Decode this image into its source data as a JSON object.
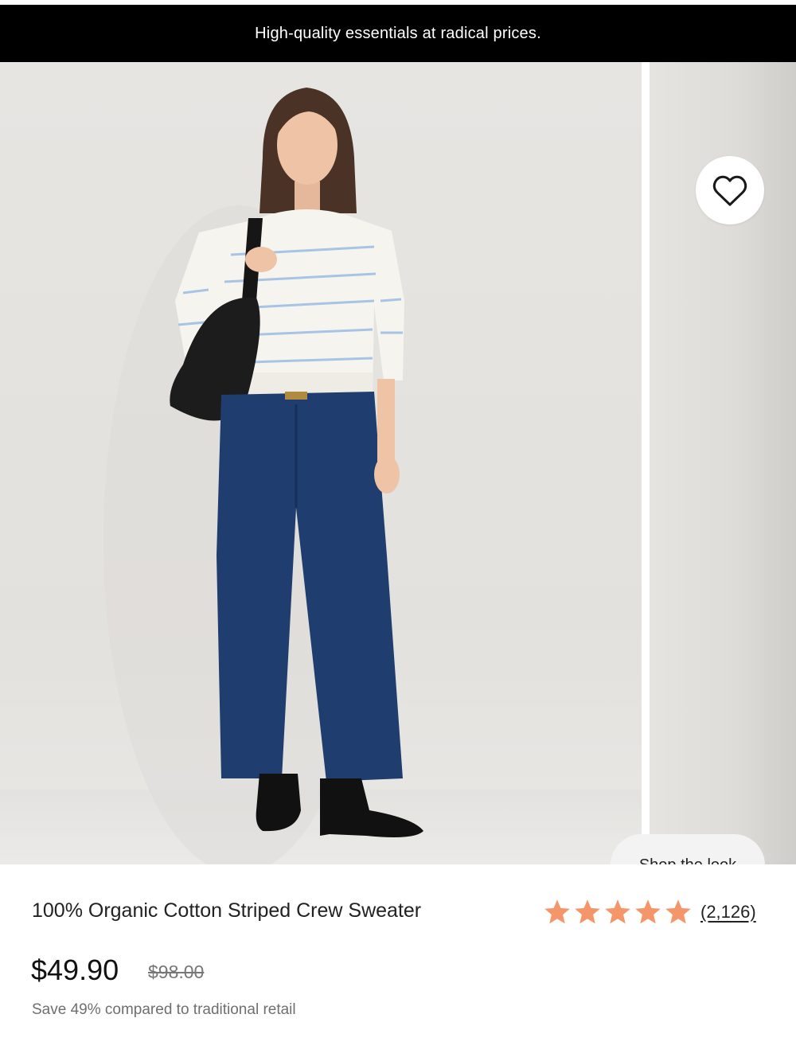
{
  "promo_banner": {
    "text": "High-quality essentials at radical prices."
  },
  "gallery": {
    "favorite_icon": "heart-outline-icon",
    "shop_the_look_label": "Shop the look"
  },
  "product": {
    "title": "100% Organic Cotton Striped Crew Sweater",
    "rating": {
      "stars": 5,
      "max_stars": 5,
      "review_count": "(2,126)",
      "star_color": "#F4956A"
    },
    "price": "$49.90",
    "compare_at_price": "$98.00",
    "savings_text": "Save 49% compared to traditional retail"
  },
  "colors": {
    "promo_bg": "#000000",
    "promo_text": "#FFFFFF",
    "star": "#F4956A"
  }
}
